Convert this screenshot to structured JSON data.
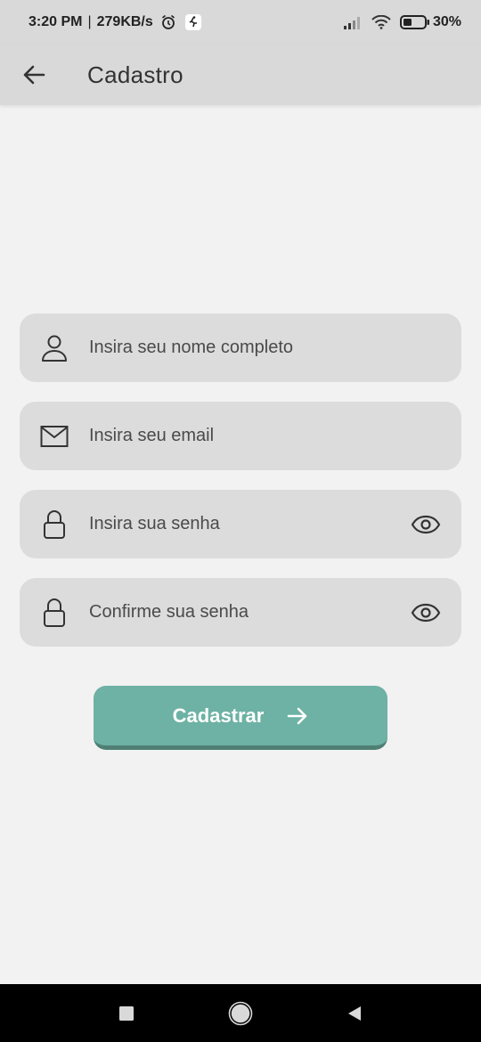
{
  "status_bar": {
    "time": "3:20 PM",
    "speed": "279KB/s",
    "battery": "30%",
    "icons": [
      "alarm-icon",
      "runner-icon",
      "signal-icon",
      "wifi-icon",
      "battery-icon"
    ]
  },
  "app_bar": {
    "title": "Cadastro",
    "back_icon": "arrow-left-icon"
  },
  "form": {
    "name_placeholder": "Insira seu nome completo",
    "email_placeholder": "Insira seu email",
    "password_placeholder": "Insira sua senha",
    "confirm_placeholder": "Confirme sua senha",
    "submit_label": "Cadastrar"
  },
  "colors": {
    "background": "#f2f2f2",
    "bar": "#d9d9d9",
    "field": "#dcdcdc",
    "accent": "#6db2a4",
    "accent_shadow": "#4f7f74"
  },
  "nav_bar": {
    "icons": [
      "recents-square-icon",
      "home-circle-icon",
      "back-triangle-icon"
    ]
  }
}
